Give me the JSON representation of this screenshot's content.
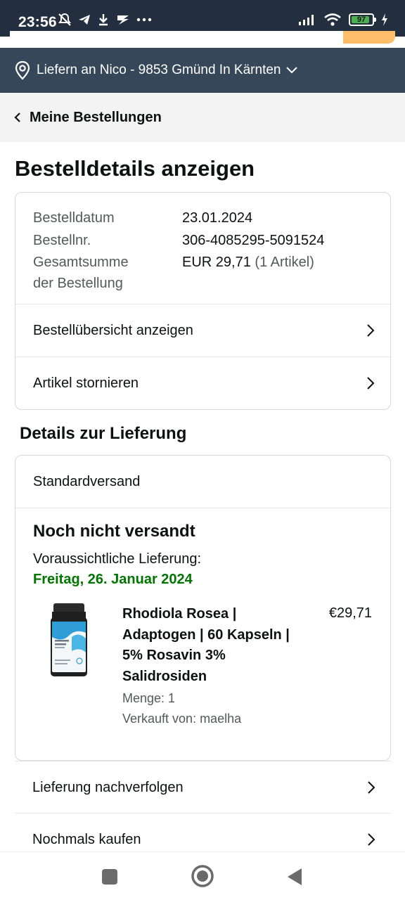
{
  "status_bar": {
    "time": "23:56",
    "battery": "97",
    "icons_left": [
      "mute-icon",
      "telegram-icon",
      "download-icon",
      "app-icon",
      "more-icon"
    ],
    "icons_right": [
      "signal-icon",
      "wifi-icon",
      "battery-icon",
      "charging-icon"
    ]
  },
  "delivery_bar": {
    "text": "Liefern an Nico - 9853 Gmünd In Kärnten"
  },
  "back_nav": {
    "label": "Meine Bestellungen"
  },
  "page_title": "Bestelldetails anzeigen",
  "order_summary": {
    "date_label": "Bestelldatum",
    "date_value": "23.01.2024",
    "number_label": "Bestellnr.",
    "number_value": "306-4085295-5091524",
    "total_label_line1": "Gesamtsumme",
    "total_label_line2": "der Bestellung",
    "total_value": "EUR 29,71",
    "total_items": "(1 Artikel)",
    "link_overview": "Bestellübersicht anzeigen",
    "link_cancel": "Artikel stornieren"
  },
  "delivery_details": {
    "section_title": "Details zur Lieferung",
    "shipping_method": "Standardversand",
    "status": "Noch nicht versandt",
    "eta_label": "Voraussichtliche Lieferung:",
    "eta_date": "Freitag, 26. Januar 2024",
    "status_color": "#007600"
  },
  "product": {
    "title": "Rhodiola Rosea | Adaptogen | 60 Kapseln | 5% Rosavin 3% Salidrosiden",
    "price": "€29,71",
    "quantity": "Menge: 1",
    "seller": "Verkauft von: maelha",
    "image_label": "maelha"
  },
  "bottom_links": {
    "track": "Lieferung nachverfolgen",
    "buy_again": "Nochmals kaufen"
  },
  "nav_bar": {
    "buttons": [
      "recents-icon",
      "home-icon",
      "back-icon"
    ]
  },
  "colors": {
    "header_dark": "#232f3e",
    "delivery_bar": "#37475a",
    "accent_orange": "#febd69",
    "eta_green": "#007600"
  }
}
